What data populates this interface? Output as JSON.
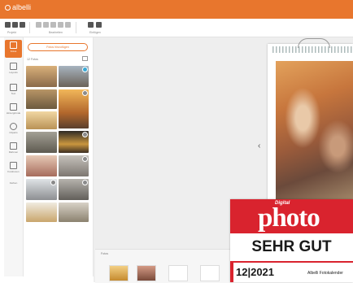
{
  "app": {
    "logo_text": "albelli",
    "accent": "#e8762d"
  },
  "toolbar": {
    "groups": [
      {
        "label": "Projekt"
      },
      {
        "label": "Bearbeiten"
      },
      {
        "label": "Einfügen"
      }
    ]
  },
  "sidebar": {
    "items": [
      {
        "label": "Fotos",
        "icon": "photos-icon",
        "active": true
      },
      {
        "label": "Layouts",
        "icon": "layout-icon"
      },
      {
        "label": "Text",
        "icon": "text-icon"
      },
      {
        "label": "Hintergründe",
        "icon": "paint-roller-icon"
      },
      {
        "label": "Cliparts",
        "icon": "clipart-icon"
      },
      {
        "label": "Rahmen",
        "icon": "frame-icon"
      },
      {
        "label": "Fotoboxen",
        "icon": "photobox-icon"
      },
      {
        "label": "Farben",
        "icon": "palette-icon"
      }
    ]
  },
  "panel": {
    "add_photos_label": "Fotos hinzufügen",
    "photo_count": "12 Fotos"
  },
  "bottom_strip": {
    "label": "Fotos"
  },
  "award": {
    "brand_small": "Digital",
    "brand": "photo",
    "rating": "SEHR GUT",
    "date": "12|2021",
    "product": "Albelli Fotokalender"
  },
  "colors": {
    "award_red": "#d9232e",
    "workspace_bg": "#eeeeee"
  }
}
